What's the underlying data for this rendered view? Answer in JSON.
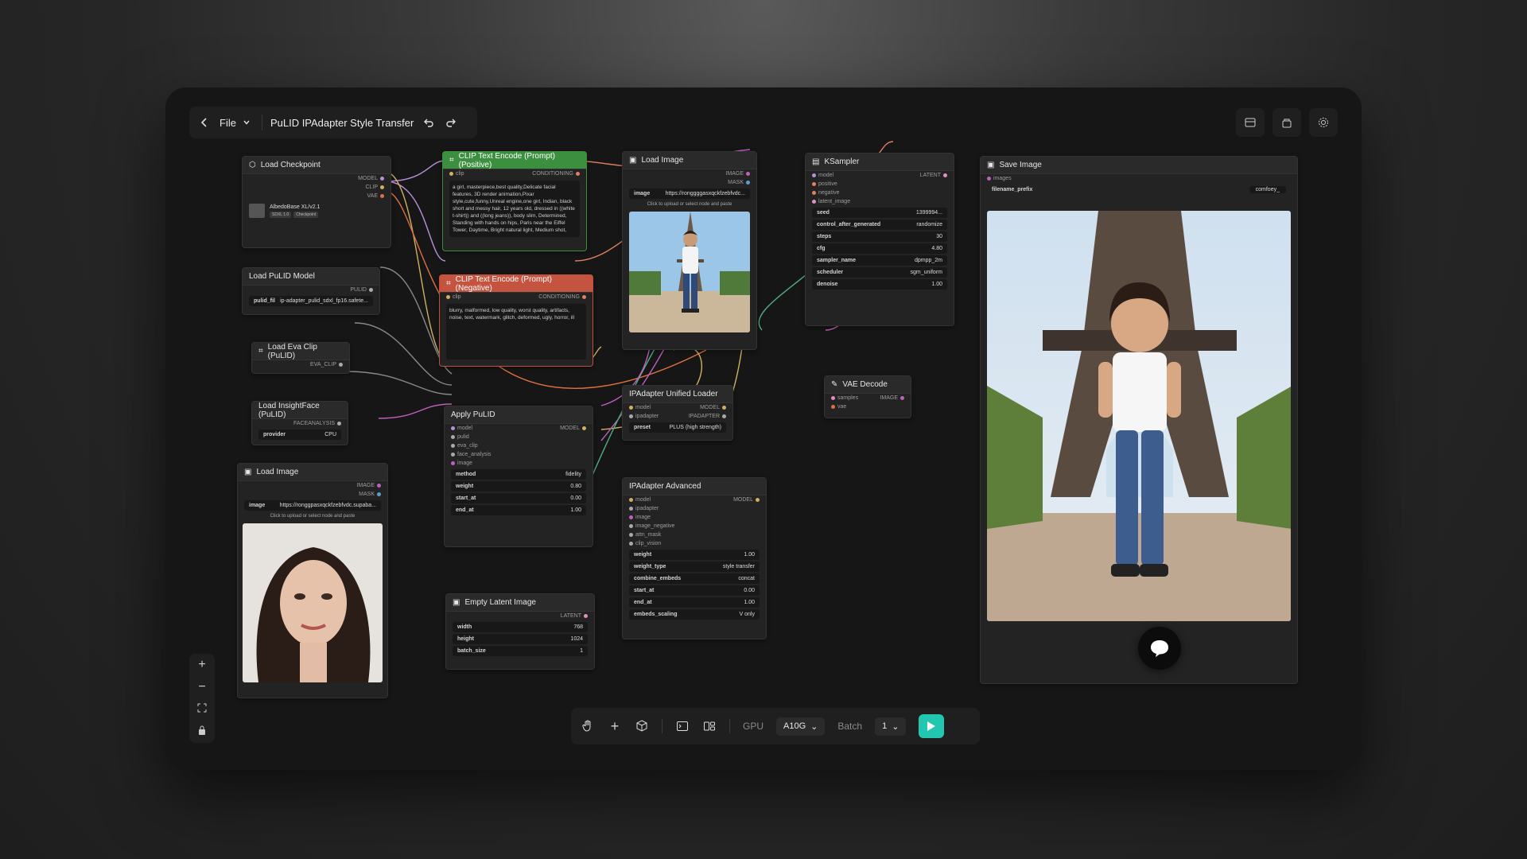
{
  "topbar": {
    "file_label": "File",
    "title": "PuLID IPAdapter Style Transfer"
  },
  "nodes": {
    "load_checkpoint": {
      "title": "Load Checkpoint",
      "outputs": [
        "MODEL",
        "CLIP",
        "VAE"
      ],
      "ckpt_name": "AlbedoBase XL/v2.1",
      "tags": [
        "SDXL 1.0",
        "Checkpoint"
      ]
    },
    "clip_positive": {
      "title": "CLIP Text Encode (Prompt)(Positive)",
      "input": "clip",
      "output": "CONDITIONING",
      "text": "a girl,  masterpiece,best quality,Delicate facial features,  3D render animation,Pixar style,cute,funny,Unreal engine,one girl, Indian, black short and messy hair, 12 years old, dressed in ((white t-shirt)) and ((long jeans)), body slim, Determined, Standing with hands on hips, Paris near the Eiffel Tower, Daytime, Bright natural light, Medium shot,"
    },
    "clip_negative": {
      "title": "CLIP Text Encode (Prompt)(Negative)",
      "input": "clip",
      "output": "CONDITIONING",
      "text": "blurry, malformed, low quality, worst quality, artifacts, noise, text, watermark, glitch, deformed, ugly, horror, ill"
    },
    "load_image_top": {
      "title": "Load Image",
      "outputs": [
        "IMAGE",
        "MASK"
      ],
      "image_label": "image",
      "image_value": "https://ronggggasxqckfzebfvdc...",
      "upload": "Click to upload or select node and paste"
    },
    "ksampler": {
      "title": "KSampler",
      "inputs": [
        "model",
        "positive",
        "negative",
        "latent_image"
      ],
      "output": "LATENT",
      "widgets": [
        {
          "label": "seed",
          "value": "1399994..."
        },
        {
          "label": "control_after_generated",
          "value": "randomize"
        },
        {
          "label": "steps",
          "value": "30"
        },
        {
          "label": "cfg",
          "value": "4.80"
        },
        {
          "label": "sampler_name",
          "value": "dpmpp_2m"
        },
        {
          "label": "scheduler",
          "value": "sgm_uniform"
        },
        {
          "label": "denoise",
          "value": "1.00"
        }
      ]
    },
    "save_image": {
      "title": "Save Image",
      "input": "images",
      "prefix_label": "filename_prefix",
      "prefix_value": "comfoey_"
    },
    "load_pulid_model": {
      "title": "Load PuLID Model",
      "output": "PULID",
      "widget_label": "pulid_fil",
      "widget_value": "ip-adapter_pulid_sdxl_fp16.safete..."
    },
    "load_eva_clip": {
      "title": "Load Eva Clip (PuLID)",
      "output": "EVA_CLIP"
    },
    "load_insightface": {
      "title": "Load InsightFace (PuLID)",
      "output": "FACEANALYSIS",
      "provider_label": "provider",
      "provider_value": "CPU"
    },
    "load_image_bottom": {
      "title": "Load Image",
      "outputs": [
        "IMAGE",
        "MASK"
      ],
      "image_label": "image",
      "image_value": "https://ronggpasxqckfzebfvdc.supaba...",
      "upload": "Click to upload or select node and paste"
    },
    "apply_pulid": {
      "title": "Apply PuLID",
      "inputs": [
        "model",
        "pulid",
        "eva_clip",
        "face_analysis",
        "image"
      ],
      "output": "MODEL",
      "widgets": [
        {
          "label": "method",
          "value": "fidelity"
        },
        {
          "label": "weight",
          "value": "0.80"
        },
        {
          "label": "start_at",
          "value": "0.00"
        },
        {
          "label": "end_at",
          "value": "1.00"
        }
      ]
    },
    "ipadapter_loader": {
      "title": "IPAdapter Unified Loader",
      "inputs": [
        "model",
        "ipadapter"
      ],
      "outputs": [
        "MODEL",
        "IPADAPTER"
      ],
      "preset_label": "preset",
      "preset_value": "PLUS (high strength)"
    },
    "ipadapter_advanced": {
      "title": "IPAdapter Advanced",
      "inputs": [
        "model",
        "ipadapter",
        "image",
        "image_negative",
        "attn_mask",
        "clip_vision"
      ],
      "output": "MODEL",
      "widgets": [
        {
          "label": "weight",
          "value": "1.00"
        },
        {
          "label": "weight_type",
          "value": "style transfer"
        },
        {
          "label": "combine_embeds",
          "value": "concat"
        },
        {
          "label": "start_at",
          "value": "0.00"
        },
        {
          "label": "end_at",
          "value": "1.00"
        },
        {
          "label": "embeds_scaling",
          "value": "V only"
        }
      ]
    },
    "vae_decode": {
      "title": "VAE Decode",
      "inputs": [
        "samples",
        "vae"
      ],
      "output": "IMAGE"
    },
    "empty_latent": {
      "title": "Empty Latent Image",
      "output": "LATENT",
      "widgets": [
        {
          "label": "width",
          "value": "768"
        },
        {
          "label": "height",
          "value": "1024"
        },
        {
          "label": "batch_size",
          "value": "1"
        }
      ]
    }
  },
  "bottombar": {
    "gpu_label": "GPU",
    "gpu_value": "A10G",
    "batch_label": "Batch",
    "batch_value": "1"
  },
  "zoom": {
    "plus": "+",
    "minus": "−"
  },
  "colors": {
    "accent": "#22c7b0",
    "positive": "#3c8f3e",
    "negative": "#c4533f"
  }
}
